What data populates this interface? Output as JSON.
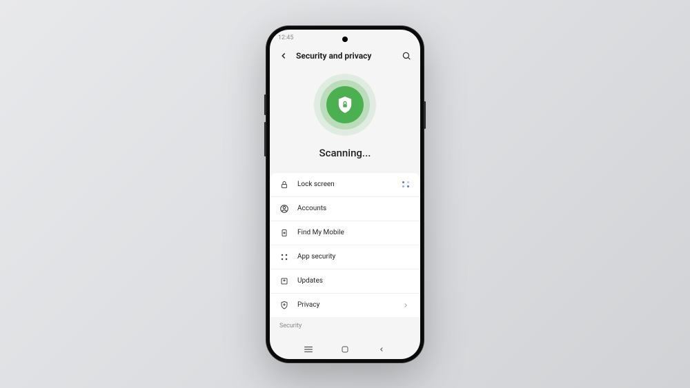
{
  "statusbar": {
    "time": "12:45"
  },
  "header": {
    "title": "Security and privacy"
  },
  "scan": {
    "status": "Scanning..."
  },
  "items": [
    {
      "label": "Lock screen",
      "icon": "lock",
      "trailing": "loading"
    },
    {
      "label": "Accounts",
      "icon": "person",
      "trailing": ""
    },
    {
      "label": "Find My Mobile",
      "icon": "find",
      "trailing": ""
    },
    {
      "label": "App security",
      "icon": "apps",
      "trailing": ""
    },
    {
      "label": "Updates",
      "icon": "update",
      "trailing": ""
    },
    {
      "label": "Privacy",
      "icon": "privacy",
      "trailing": "chevron"
    }
  ],
  "section": {
    "label": "Security"
  }
}
